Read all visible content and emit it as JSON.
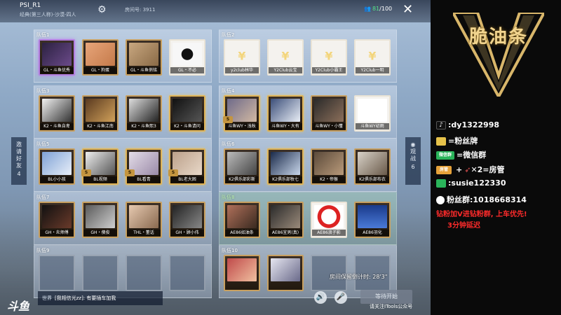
{
  "header": {
    "mode_title": "PSI_R1",
    "mode_subtitle": "经典(第三人称)-沙漠-四人",
    "room_number": "房间号: 3911",
    "player_current": "81",
    "player_max": "/100"
  },
  "side": {
    "invite_label": "邀请好友",
    "invite_count": "4",
    "watch_label": "观战",
    "watch_count": "6"
  },
  "teams": [
    {
      "label": "队伍1",
      "slots": [
        "GL・斗鱼优秀",
        "GL・狗蛋",
        "GL・斗鱼俏铭",
        "GL・不必"
      ]
    },
    {
      "label": "队伍2",
      "slots": [
        "y2club林华",
        "Y2Club云宝",
        "Y2Club小霸王",
        "Y2Club一明"
      ]
    },
    {
      "label": "队伍3",
      "slots": [
        "K2・斗鱼自卑",
        "K2・斗鱼江南",
        "K2・斗鱼熙3",
        "K2・斗鱼请问"
      ]
    },
    {
      "label": "队伍4",
      "slots": [
        "斗鱼WY・浅秋",
        "斗鱼WY・大有",
        "斗鱼WY・小懂",
        "斗鱼WY初雨"
      ]
    },
    {
      "label": "队伍5",
      "slots": [
        "BL小小孩",
        "BL视频",
        "BL看青",
        "BL老大困"
      ]
    },
    {
      "label": "队伍6",
      "slots": [
        "K2俱乐部彩斯",
        "K2俱乐部牧七",
        "K2・帝猴",
        "K2俱乐部布衣"
      ]
    },
    {
      "label": "队伍7",
      "slots": [
        "GH・炎师傅",
        "GH・傻俊",
        "THL・董话",
        "GH・顾小伟"
      ]
    },
    {
      "label": "队伍8",
      "slots": [
        "AE86如油条",
        "AE86宜男(真)",
        "AE86浪子影",
        "AE86羽化"
      ]
    },
    {
      "label": "队伍9",
      "slots": [
        "",
        "",
        "",
        ""
      ]
    },
    {
      "label": "队伍10",
      "slots": [
        "",
        "",
        "",
        ""
      ]
    }
  ],
  "bottom": {
    "countdown": "房间保留倒计时: 28'3\"",
    "logo": "斗鱼",
    "chat_channel": "世界",
    "chat_text": "[我相信光zz]: 有要插车加我",
    "start_label": "等待开始",
    "follow_text": "请关注ITools公众号"
  },
  "stream": {
    "brand": "脆油条",
    "douyin": ":dy1322998",
    "fan_badge": "=粉丝牌",
    "wechat_group_tag": "微信群",
    "wechat_group": "=微信群",
    "manager_tag": "房管",
    "manager": "✕2=房管",
    "wechat": ":susie122330",
    "fan_group": "粉丝群:1018668314",
    "notice1": "钻粉加V进钻粉群, 上车优先!",
    "notice2": "3分钟延迟"
  },
  "colors": {
    "stream_gold": "#f1d48e",
    "notice_red": "#ff2b2b",
    "team8_label": "#bff5b3"
  }
}
